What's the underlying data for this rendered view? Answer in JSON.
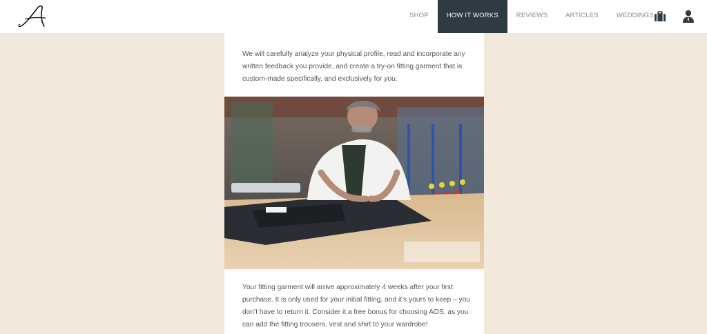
{
  "brand": {
    "logo_text": "A"
  },
  "nav": {
    "items": [
      {
        "label": "SHOP",
        "active": false
      },
      {
        "label": "HOW IT WORKS",
        "active": true
      },
      {
        "label": "REVIEWS",
        "active": false
      },
      {
        "label": "ARTICLES",
        "active": false
      },
      {
        "label": "WEDDINGS",
        "active": false
      }
    ],
    "icons": [
      "briefcase-icon",
      "account-icon"
    ],
    "active_color": "#2f3b42"
  },
  "main": {
    "intro_text": "We will carefully analyze your physical profile, read and incorporate any written feedback you provide, and create a try-on fitting garment that is custom-made specifically, and exclusively for",
    "intro_emphasis": "you",
    "intro_end": ".",
    "fitting_text": "Your fitting garment will arrive approximately 4 weeks after your first purchase. It is only used for your initial fitting, and it’s yours to keep – you don’t have to return it. Consider it a free bonus for choosing AOS, as you can add the fitting trousers, vest and shirt to your wardrobe!"
  },
  "colors": {
    "page_background": "#f3e8dc",
    "panel_background": "#ffffff",
    "text": "#555555"
  }
}
